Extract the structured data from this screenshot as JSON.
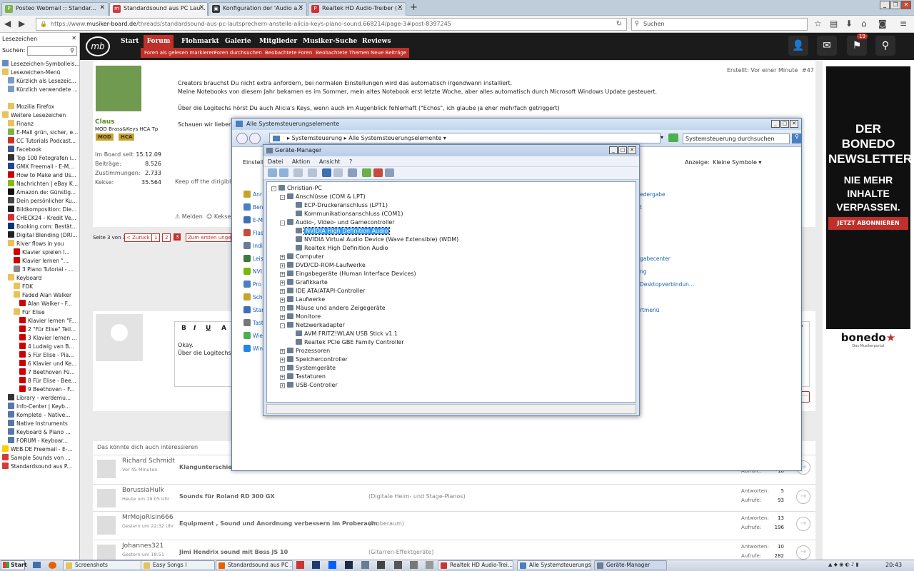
{
  "browser": {
    "tabs": [
      {
        "label": "Posteo Webmail :: Standar...",
        "icon": "posteo-icon",
        "color": "#7cb342"
      },
      {
        "label": "Standardsound aus PC Lau...",
        "icon": "musiker-board-icon",
        "color": "#d23b3b",
        "active": true
      },
      {
        "label": "Konfiguration der 'Audio a...",
        "icon": "page-icon",
        "color": "#333333"
      },
      {
        "label": "Realtek HD Audio-Treiber (...",
        "icon": "pdf-icon",
        "color": "#d32f2f"
      }
    ],
    "new_tab": "+",
    "url_prefix": "https://www.",
    "url_domain": "musiker-board.de",
    "url_rest": "/threads/standardsound-aus-pc-lautsprechern-anstelle-alicia-keys-piano-sound.668214/page-3#post-8397245",
    "search_placeholder": "Suchen",
    "window_controls": [
      "_",
      "❐",
      "✕"
    ]
  },
  "sidebar": {
    "title": "Lesezeichen",
    "search_label": "Suchen:",
    "items": [
      {
        "label": "Lesezeichen-Symbolleis...",
        "indent": 0,
        "color": "#6b8bbf"
      },
      {
        "label": "Lesezeichen-Menü",
        "indent": 0,
        "color": "#e8c25a"
      },
      {
        "label": "Kürzlich als Lesezeic...",
        "indent": 1,
        "color": "#7a9cc9"
      },
      {
        "label": "Kürzlich verwendete ...",
        "indent": 1,
        "color": "#7a9cc9"
      },
      {
        "label": "",
        "indent": 1,
        "color": ""
      },
      {
        "label": "Mozilla Firefox",
        "indent": 1,
        "color": "#e8c25a"
      },
      {
        "label": "Weitere Lesezeichen",
        "indent": 0,
        "color": "#e8c25a"
      },
      {
        "label": "Finanz",
        "indent": 1,
        "color": "#e8c25a"
      },
      {
        "label": "E-Mail grün, sicher, e...",
        "indent": 1,
        "color": "#7cb342"
      },
      {
        "label": "CC Tutorials Podcast...",
        "indent": 1,
        "color": "#d32f2f"
      },
      {
        "label": "Facebook",
        "indent": 1,
        "color": "#3b5998"
      },
      {
        "label": "Top 100 Fotografen i...",
        "indent": 1,
        "color": "#333333"
      },
      {
        "label": "GMX Freemail - E-M...",
        "indent": 1,
        "color": "#1c449b"
      },
      {
        "label": "How to Make and Us...",
        "indent": 1,
        "color": "#cc0000"
      },
      {
        "label": "Nachrichten | eBay K...",
        "indent": 1,
        "color": "#86b817"
      },
      {
        "label": "Amazon.de: Günstig...",
        "indent": 1,
        "color": "#111111"
      },
      {
        "label": "Dein persönlicher Ku...",
        "indent": 1,
        "color": "#444444"
      },
      {
        "label": "Bildkomposition: Die...",
        "indent": 1,
        "color": "#222222"
      },
      {
        "label": "CHECK24 - Kredit Ve...",
        "indent": 1,
        "color": "#d32f2f"
      },
      {
        "label": "Booking.com: Bestät...",
        "indent": 1,
        "color": "#003580"
      },
      {
        "label": "Digital Blending (DRI...",
        "indent": 1,
        "color": "#222222"
      },
      {
        "label": "River flows in you",
        "indent": 1,
        "color": "#e8c25a"
      },
      {
        "label": "Klavier spielen l...",
        "indent": 2,
        "color": "#cc0000"
      },
      {
        "label": "Klavier lernen \"...",
        "indent": 2,
        "color": "#cc0000"
      },
      {
        "label": "3 Piano Tutorial - ...",
        "indent": 2,
        "color": "#888888"
      },
      {
        "label": "Keyboard",
        "indent": 1,
        "color": "#e8c25a"
      },
      {
        "label": "FDK",
        "indent": 2,
        "color": "#e8c25a"
      },
      {
        "label": "Faded Alan Walker",
        "indent": 2,
        "color": "#e8c25a"
      },
      {
        "label": "Alan Walker - F...",
        "indent": 3,
        "color": "#cc0000"
      },
      {
        "label": "Für Elise",
        "indent": 2,
        "color": "#e8c25a"
      },
      {
        "label": "Klavier lernen \"F...",
        "indent": 3,
        "color": "#cc0000"
      },
      {
        "label": "2 \"Für Elise\" Teil...",
        "indent": 3,
        "color": "#cc0000"
      },
      {
        "label": "3 Klavier lernen ...",
        "indent": 3,
        "color": "#cc0000"
      },
      {
        "label": "4 Ludwig van B...",
        "indent": 3,
        "color": "#cc0000"
      },
      {
        "label": "5 Für Elise - Pia...",
        "indent": 3,
        "color": "#cc0000"
      },
      {
        "label": "6 Klavier und Ke...",
        "indent": 3,
        "color": "#cc0000"
      },
      {
        "label": "7 Beethoven Fü...",
        "indent": 3,
        "color": "#cc0000"
      },
      {
        "label": "8 Für Elise - Bee...",
        "indent": 3,
        "color": "#cc0000"
      },
      {
        "label": "9 Beethoven - F...",
        "indent": 3,
        "color": "#cc0000"
      },
      {
        "label": "Library - werdemu...",
        "indent": 1,
        "color": "#333333"
      },
      {
        "label": "Info-Center | Keyb...",
        "indent": 1,
        "color": "#5577aa"
      },
      {
        "label": "Komplete – Native...",
        "indent": 1,
        "color": "#5577aa"
      },
      {
        "label": "Native Instruments",
        "indent": 1,
        "color": "#5577aa"
      },
      {
        "label": "Keyboard & Piano ...",
        "indent": 1,
        "color": "#5577aa"
      },
      {
        "label": "FORUM - Keyboar...",
        "indent": 1,
        "color": "#5577aa"
      },
      {
        "label": "WEB.DE Freemail - E-...",
        "indent": 0,
        "color": "#ffcc00"
      },
      {
        "label": "Sample Sounds von ...",
        "indent": 0,
        "color": "#d23b3b"
      },
      {
        "label": "Standardsound aus P...",
        "indent": 0,
        "color": "#d23b3b"
      }
    ]
  },
  "site": {
    "logo": "mb",
    "menu": [
      "Start",
      "Forum",
      "Flohmarkt",
      "Galerie",
      "Mitglieder",
      "Musiker-Suche",
      "Reviews"
    ],
    "submenu": [
      "Foren als gelesen markieren",
      "Foren durchsuchen",
      "Beobachtete Foren",
      "Beobachtete Themen",
      "Neue Beiträge"
    ],
    "notification_count": "19"
  },
  "post": {
    "author": "Claus",
    "author_subtitle": "MOD Brass&Keys HCA Tp",
    "badges": [
      "MOD",
      "HCA"
    ],
    "stats": [
      {
        "label": "Im Board seit:",
        "value": "15.12.09"
      },
      {
        "label": "Beiträge:",
        "value": "8.526"
      },
      {
        "label": "Zustimmungen:",
        "value": "2.733"
      },
      {
        "label": "Kekse:",
        "value": "35.564"
      }
    ],
    "created": "Erstellt: Vor einer Minute",
    "post_number": "#47",
    "lines": [
      "Creators brauchst Du nicht extra anfordern, bei normalen Einstellungen wird das automatisch irgendwann installiert.",
      "Meine Notebooks von diesem Jahr bekamen es im Sommer, mein altes Notebook erst letzte Woche, aber alles automatisch durch Microsoft Windows Update gesteuert.",
      "",
      "Über die Logitechs hörst Du auch Alicia's Keys, wenn auch im Augenblick fehlerhaft (\"Echos\", ich glaube ja eher mehrfach getriggert)",
      "",
      "Schauen wir lieber"
    ],
    "signature": "Keep off the dirigible",
    "actions": [
      "Melden",
      "Kekse"
    ]
  },
  "pagination": {
    "label": "Seite 3 von 3",
    "back": "< Zurück",
    "pages": [
      "1",
      "2",
      "3"
    ],
    "first_unread": "Zum ersten ungele"
  },
  "ad": {
    "headline": [
      "DER BONEDO",
      "NEWSLETTER"
    ],
    "subline": [
      "NIE MEHR",
      "INHALTE",
      "VERPASSEN."
    ],
    "button": "JETZT ABONNIEREN",
    "brand": "bonedo",
    "brand_tag": "Das Musikerportal"
  },
  "reply": {
    "editor_buttons": [
      "B",
      "I",
      "U",
      "A"
    ],
    "text_lines": [
      "Okay.",
      "Über die Logitechs l"
    ]
  },
  "related": {
    "title": "Das könnte dich auch interessieren",
    "rows": [
      {
        "user": "Richard Schmidt",
        "time": "Vor 45 Minuten",
        "thread": "Klangunterschie",
        "forum": "",
        "replies": "",
        "views": "18"
      },
      {
        "user": "BorussiaHulk",
        "time": "Heute um 19:05 Uhr",
        "thread": "Sounds für Roland RD 300 GX",
        "forum": "(Digitale Heim- und Stage-Pianos)",
        "replies": "5",
        "views": "93"
      },
      {
        "user": "MrMojoRisin666",
        "time": "Gestern um 22:32 Uhr",
        "thread": "Equipment , Sound und Anordnung verbessern im Proberaum",
        "forum": "(Proberaum)",
        "replies": "13",
        "views": "196"
      },
      {
        "user": "Johannes321",
        "time": "Gestern um 18:51",
        "thread": "Jimi Hendrix sound mit Boss JS 10",
        "forum": "(Gitarren-Effektgeräte)",
        "replies": "10",
        "views": "282"
      }
    ],
    "replies_label": "Antworten:",
    "views_label": "Aufrufe:"
  },
  "control_panel": {
    "title": "Alle Systemsteuerungselemente",
    "breadcrumb": [
      "Systemsteuerung",
      "Alle Systemsteuerungselemente"
    ],
    "search_placeholder": "Systemsteuerung durchsuchen",
    "settings_label": "Einstellu",
    "view_label": "Anzeige:",
    "view_value": "Kleine Symbole",
    "left_items": [
      "Anr",
      "Ben",
      "E-M",
      "Flas",
      "Indi",
      "Leis",
      "NVI",
      "Pro",
      "Sch",
      "Star",
      "Tast",
      "Wie",
      "Win"
    ],
    "right_items": [
      "edergabe",
      "t",
      "gabecenter",
      "ng",
      "Desktopverbindun...",
      "rtmenü"
    ]
  },
  "device_manager": {
    "title": "Geräte-Manager",
    "menu": [
      "Datei",
      "Aktion",
      "Ansicht",
      "?"
    ],
    "tree": [
      {
        "label": "Christian-PC",
        "level": 0,
        "expander": "-"
      },
      {
        "label": "Anschlüsse (COM & LPT)",
        "level": 1,
        "expander": "-"
      },
      {
        "label": "ECP-Druckeranschluss (LPT1)",
        "level": 2,
        "expander": ""
      },
      {
        "label": "Kommunikationsanschluss (COM1)",
        "level": 2,
        "expander": ""
      },
      {
        "label": "Audio-, Video- und Gamecontroller",
        "level": 1,
        "expander": "-"
      },
      {
        "label": "NVIDIA High Definition Audio",
        "level": 2,
        "expander": "",
        "selected": true
      },
      {
        "label": "NVIDIA Virtual Audio Device (Wave Extensible) (WDM)",
        "level": 2,
        "expander": ""
      },
      {
        "label": "Realtek High Definition Audio",
        "level": 2,
        "expander": ""
      },
      {
        "label": "Computer",
        "level": 1,
        "expander": "+"
      },
      {
        "label": "DVD/CD-ROM-Laufwerke",
        "level": 1,
        "expander": "+"
      },
      {
        "label": "Eingabegeräte (Human Interface Devices)",
        "level": 1,
        "expander": "+"
      },
      {
        "label": "Grafikkarte",
        "level": 1,
        "expander": "+"
      },
      {
        "label": "IDE ATA/ATAPI-Controller",
        "level": 1,
        "expander": "+"
      },
      {
        "label": "Laufwerke",
        "level": 1,
        "expander": "+"
      },
      {
        "label": "Mäuse und andere Zeigegeräte",
        "level": 1,
        "expander": "+"
      },
      {
        "label": "Monitore",
        "level": 1,
        "expander": "+"
      },
      {
        "label": "Netzwerkadapter",
        "level": 1,
        "expander": "-"
      },
      {
        "label": "AVM FRITZ!WLAN USB Stick v1.1",
        "level": 2,
        "expander": ""
      },
      {
        "label": "Realtek PCIe GBE Family Controller",
        "level": 2,
        "expander": ""
      },
      {
        "label": "Prozessoren",
        "level": 1,
        "expander": "+"
      },
      {
        "label": "Speichercontroller",
        "level": 1,
        "expander": "+"
      },
      {
        "label": "Systemgeräte",
        "level": 1,
        "expander": "+"
      },
      {
        "label": "Tastaturen",
        "level": 1,
        "expander": "+"
      },
      {
        "label": "USB-Controller",
        "level": 1,
        "expander": "+"
      }
    ]
  },
  "taskbar": {
    "start": "Start",
    "items": [
      {
        "label": "Screenshots",
        "color": "#e8c25a"
      },
      {
        "label": "Easy Songs I",
        "color": "#e8c25a"
      },
      {
        "label": "Standardsound aus PC ...",
        "color": "#e66000"
      },
      {
        "label": "Realtek HD Audio-Trei...",
        "color": "#cc3333"
      },
      {
        "label": "Alle Systemsteuerungs...",
        "color": "#4a7fc0"
      },
      {
        "label": "Geräte-Manager",
        "color": "#6b7d93",
        "active": true
      }
    ],
    "clock": "20:43"
  }
}
